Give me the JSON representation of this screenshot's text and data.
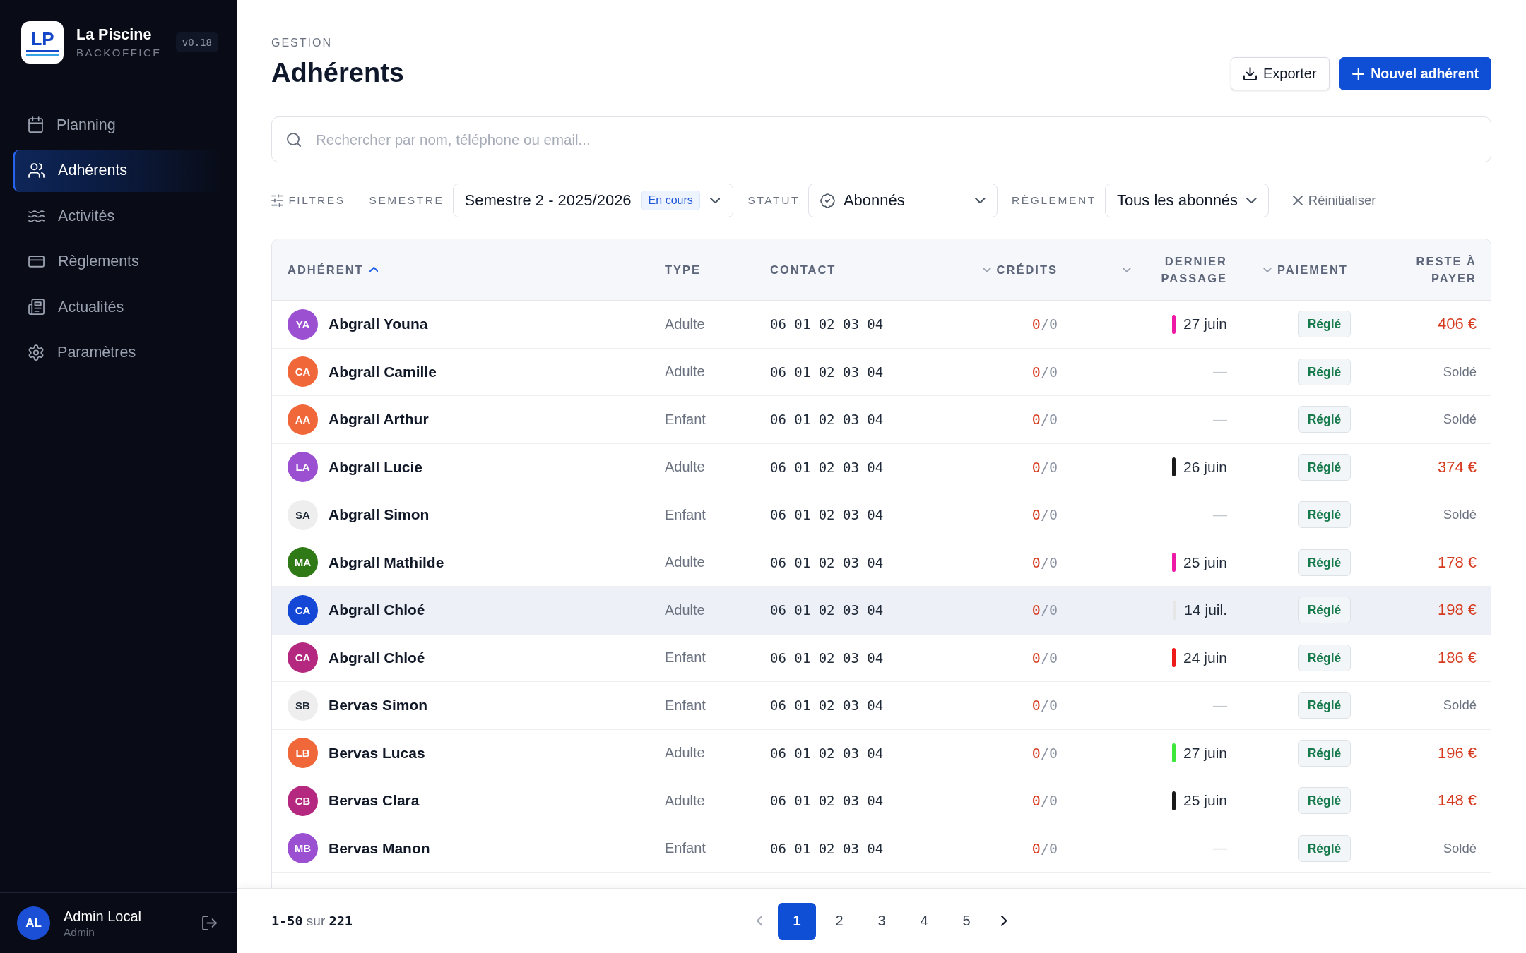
{
  "sidebar": {
    "logo": "LP",
    "title": "La Piscine",
    "subtitle": "BACKOFFICE",
    "version": "v0.18",
    "nav": [
      {
        "label": "Planning",
        "selected": false
      },
      {
        "label": "Adhérents",
        "selected": true
      },
      {
        "label": "Activités",
        "selected": false
      },
      {
        "label": "Règlements",
        "selected": false
      },
      {
        "label": "Actualités",
        "selected": false
      },
      {
        "label": "Paramètres",
        "selected": false
      }
    ],
    "user": {
      "initials": "AL",
      "name": "Admin Local",
      "role": "Admin"
    }
  },
  "page": {
    "eyebrow": "GESTION",
    "title": "Adhérents",
    "actions": [
      {
        "label": "Exporter",
        "kind": "secondary"
      },
      {
        "label": "Nouvel adhérent",
        "kind": "primary"
      }
    ]
  },
  "search": {
    "placeholder": "Rechercher par nom, téléphone ou email..."
  },
  "filters": {
    "title": "FILTRES",
    "semester": {
      "label": "SEMESTRE",
      "value": "Semestre 2 - 2025/2026",
      "badge": "En cours"
    },
    "status": {
      "label": "STATUT",
      "value": "Abonnés"
    },
    "payment": {
      "label": "RÈGLEMENT",
      "value": "Tous les abonnés"
    },
    "reset": "Réinitialiser"
  },
  "table": {
    "columns": [
      {
        "label": "ADHÉRENT",
        "sorted": true
      },
      {
        "label": "TYPE"
      },
      {
        "label": "CONTACT"
      },
      {
        "label": "CRÉDITS",
        "sorted": false
      },
      {
        "label": "DERNIER PASSAGE",
        "sorted": false
      },
      {
        "label": "PAIEMENT",
        "sorted": false
      },
      {
        "label": "RESTE À PAYER"
      }
    ],
    "rows": [
      {
        "initials": "YA",
        "color": "#9b4fd1",
        "name": "Abgrall Youna",
        "type": "Adulte",
        "contact": "06 01 02 03 04",
        "credits_used": "0",
        "credits_rest": "/0",
        "credits_low": true,
        "passage": {
          "date": "27 juin",
          "color": "#ee1aa6"
        },
        "payment": "Réglé",
        "paid": true,
        "balance": "406 €",
        "balance_due": true,
        "highlighted": false
      },
      {
        "initials": "CA",
        "color": "#f0673a",
        "name": "Abgrall Camille",
        "type": "Adulte",
        "contact": "06 01 02 03 04",
        "credits_used": "0",
        "credits_rest": "/0",
        "credits_low": true,
        "passage": {
          "date": "—"
        },
        "payment": "Réglé",
        "paid": true,
        "balance": "Soldé",
        "balance_due": false,
        "highlighted": false
      },
      {
        "initials": "AA",
        "color": "#f0673a",
        "name": "Abgrall Arthur",
        "type": "Enfant",
        "contact": "06 01 02 03 04",
        "credits_used": "0",
        "credits_rest": "/0",
        "credits_low": true,
        "passage": {
          "date": "—"
        },
        "payment": "Réglé",
        "paid": true,
        "balance": "Soldé",
        "balance_due": false,
        "highlighted": false
      },
      {
        "initials": "LA",
        "color": "#9b4fd1",
        "name": "Abgrall Lucie",
        "type": "Adulte",
        "contact": "06 01 02 03 04",
        "credits_used": "0",
        "credits_rest": "/0",
        "credits_low": true,
        "passage": {
          "date": "26 juin",
          "color": "#1a1a1a"
        },
        "payment": "Réglé",
        "paid": true,
        "balance": "374 €",
        "balance_due": true,
        "highlighted": false
      },
      {
        "initials": "SA",
        "color": "#eeeeee",
        "name": "Abgrall Simon",
        "type": "Enfant",
        "contact": "06 01 02 03 04",
        "credits_used": "0",
        "credits_rest": "/0",
        "credits_low": true,
        "passage": {
          "date": "—"
        },
        "payment": "Réglé",
        "paid": true,
        "balance": "Soldé",
        "balance_due": false,
        "highlighted": false
      },
      {
        "initials": "MA",
        "color": "#2f7a16",
        "name": "Abgrall Mathilde",
        "type": "Adulte",
        "contact": "06 01 02 03 04",
        "credits_used": "0",
        "credits_rest": "/0",
        "credits_low": true,
        "passage": {
          "date": "25 juin",
          "color": "#ee1aa6"
        },
        "payment": "Réglé",
        "paid": true,
        "balance": "178 €",
        "balance_due": true,
        "highlighted": false
      },
      {
        "initials": "CA",
        "color": "#1447d6",
        "name": "Abgrall Chloé",
        "type": "Adulte",
        "contact": "06 01 02 03 04",
        "credits_used": "0",
        "credits_rest": "/0",
        "credits_low": true,
        "passage": {
          "date": "14 juil.",
          "color": "#e6e6e6"
        },
        "payment": "Réglé",
        "paid": true,
        "balance": "198 €",
        "balance_due": true,
        "highlighted": true
      },
      {
        "initials": "CA",
        "color": "#b5287f",
        "name": "Abgrall Chloé",
        "type": "Enfant",
        "contact": "06 01 02 03 04",
        "credits_used": "0",
        "credits_rest": "/0",
        "credits_low": true,
        "passage": {
          "date": "24 juin",
          "color": "#ee1b1b"
        },
        "payment": "Réglé",
        "paid": true,
        "balance": "186 €",
        "balance_due": true,
        "highlighted": false
      },
      {
        "initials": "SB",
        "color": "#eeeeee",
        "name": "Bervas Simon",
        "type": "Enfant",
        "contact": "06 01 02 03 04",
        "credits_used": "0",
        "credits_rest": "/0",
        "credits_low": true,
        "passage": {
          "date": "—"
        },
        "payment": "Réglé",
        "paid": true,
        "balance": "Soldé",
        "balance_due": false,
        "highlighted": false
      },
      {
        "initials": "LB",
        "color": "#f0673a",
        "name": "Bervas Lucas",
        "type": "Adulte",
        "contact": "06 01 02 03 04",
        "credits_used": "0",
        "credits_rest": "/0",
        "credits_low": true,
        "passage": {
          "date": "27 juin",
          "color": "#3ee83a"
        },
        "payment": "Réglé",
        "paid": true,
        "balance": "196 €",
        "balance_due": true,
        "highlighted": false
      },
      {
        "initials": "CB",
        "color": "#b5287f",
        "name": "Bervas Clara",
        "type": "Adulte",
        "contact": "06 01 02 03 04",
        "credits_used": "0",
        "credits_rest": "/0",
        "credits_low": true,
        "passage": {
          "date": "25 juin",
          "color": "#1a1a1a"
        },
        "payment": "Réglé",
        "paid": true,
        "balance": "148 €",
        "balance_due": true,
        "highlighted": false
      },
      {
        "initials": "MB",
        "color": "#9b4fd1",
        "name": "Bervas Manon",
        "type": "Enfant",
        "contact": "06 01 02 03 04",
        "credits_used": "0",
        "credits_rest": "/0",
        "credits_low": true,
        "passage": {
          "date": "—"
        },
        "payment": "Réglé",
        "paid": true,
        "balance": "Soldé",
        "balance_due": false,
        "highlighted": false
      }
    ]
  },
  "pagination": {
    "range": "1-50",
    "of": "sur",
    "total": "221",
    "prev_disabled": true,
    "next_disabled": false,
    "pages": [
      {
        "label": "1",
        "selected": true
      },
      {
        "label": "2",
        "selected": false
      },
      {
        "label": "3",
        "selected": false
      },
      {
        "label": "4",
        "selected": false
      },
      {
        "label": "5",
        "selected": false
      }
    ]
  }
}
